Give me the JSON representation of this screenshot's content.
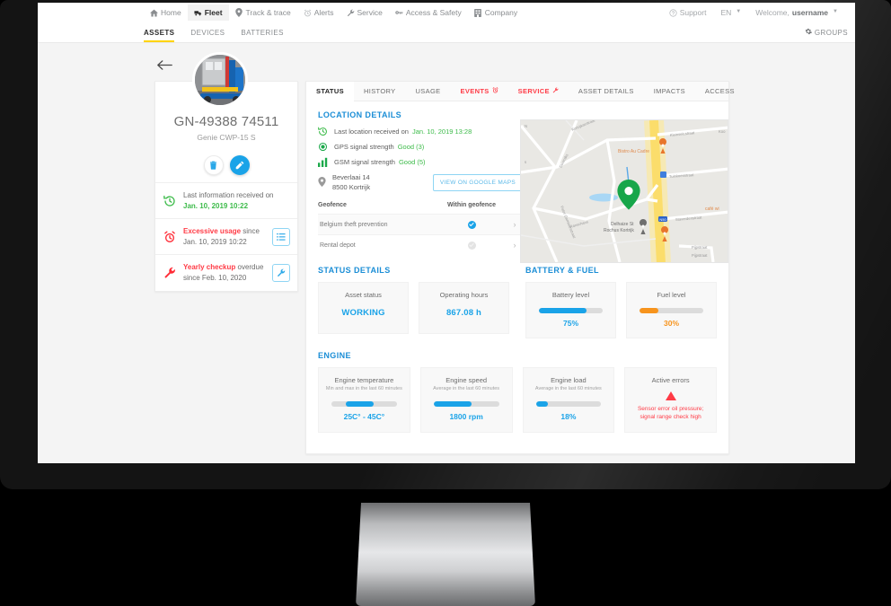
{
  "topnav": {
    "items": [
      {
        "label": "Home",
        "icon": "home-icon",
        "active": false
      },
      {
        "label": "Fleet",
        "icon": "truck-icon",
        "active": true
      },
      {
        "label": "Track & trace",
        "icon": "pin-icon",
        "active": false
      },
      {
        "label": "Alerts",
        "icon": "alarm-clock-icon",
        "active": false
      },
      {
        "label": "Service",
        "icon": "wrench-icon",
        "active": false
      },
      {
        "label": "Access & Safety",
        "icon": "key-icon",
        "active": false
      },
      {
        "label": "Company",
        "icon": "building-icon",
        "active": false
      }
    ],
    "support": "Support",
    "language": "EN",
    "welcome_prefix": "Welcome,",
    "username": "username"
  },
  "subnav": {
    "items": [
      {
        "label": "ASSETS",
        "active": true
      },
      {
        "label": "DEVICES",
        "active": false
      },
      {
        "label": "BATTERIES",
        "active": false
      }
    ],
    "groups_label": "GROUPS",
    "accent": "#ffd400"
  },
  "asset": {
    "back_label": "Back",
    "title": "GN-49388 74511",
    "subtitle": "Genie CWP-15 S",
    "delete_label": "Delete",
    "edit_label": "Edit",
    "rows": [
      {
        "icon": "history-clock-icon",
        "text_lead": "Last information received on",
        "text_value": "Jan. 10, 2019 10:22",
        "lead_style": "grey",
        "value_style": "green",
        "action_icon": null
      },
      {
        "icon": "alarm-clock-icon",
        "text_lead": "Excessive usage",
        "text_mid": " since",
        "text_value": "Jan. 10, 2019 10:22",
        "lead_style": "red",
        "value_style": "grey",
        "action_icon": "list-icon"
      },
      {
        "icon": "wrench-icon",
        "text_lead": "Yearly checkup",
        "text_mid": " overdue",
        "text_value": "since Feb. 10, 2020",
        "lead_style": "red",
        "value_style": "grey",
        "action_icon": "wrench-icon"
      }
    ]
  },
  "tabs": [
    {
      "label": "STATUS",
      "active": true,
      "style": "normal",
      "icon": null
    },
    {
      "label": "HISTORY",
      "active": false,
      "style": "normal",
      "icon": null
    },
    {
      "label": "USAGE",
      "active": false,
      "style": "normal",
      "icon": null
    },
    {
      "label": "EVENTS",
      "active": false,
      "style": "alert",
      "icon": "alarm-clock-icon"
    },
    {
      "label": "SERVICE",
      "active": false,
      "style": "alert",
      "icon": "wrench-icon"
    },
    {
      "label": "ASSET DETAILS",
      "active": false,
      "style": "normal",
      "icon": null
    },
    {
      "label": "IMPACTS",
      "active": false,
      "style": "normal",
      "icon": null
    },
    {
      "label": "ACCESS",
      "active": false,
      "style": "normal",
      "icon": null
    }
  ],
  "location": {
    "title": "LOCATION DETAILS",
    "last_received_label": "Last location received on",
    "last_received_value": "Jan. 10, 2019 13:28",
    "gps_label": "GPS signal strength",
    "gps_value": "Good (3)",
    "gsm_label": "GSM signal strength",
    "gsm_value": "Good (5)",
    "address_line1": "Beverlaai 14",
    "address_line2": "8500 Kortrijk",
    "maps_button": "VIEW ON GOOGLE MAPS",
    "geofence_header_name": "Geofence",
    "geofence_header_within": "Within geofence",
    "geofences": [
      {
        "name": "Belgium theft prevention",
        "within": true
      },
      {
        "name": "Rental depot",
        "within": false
      }
    ],
    "map_labels": [
      "Bistro Au Cadre",
      "Delhaize St Rochus Kortrijk",
      "Kortrijksestraat",
      "Doorniksesteenweg",
      "café wi",
      "Pijpstraat",
      "N50"
    ]
  },
  "status_details": {
    "title": "STATUS DETAILS",
    "cards": [
      {
        "label": "Asset status",
        "value": "WORKING"
      },
      {
        "label": "Operating hours",
        "value": "867.08 h"
      }
    ]
  },
  "battery_fuel": {
    "title": "BATTERY & FUEL",
    "cards": [
      {
        "label": "Battery level",
        "value": "75%",
        "percent": 75,
        "color": "#1aa3e8"
      },
      {
        "label": "Fuel level",
        "value": "30%",
        "percent": 30,
        "color": "#f7941d"
      }
    ]
  },
  "engine": {
    "title": "ENGINE",
    "cards": [
      {
        "label": "Engine temperature",
        "sublabel": "Min and max in the last 60 minutes",
        "value": "25C° - 45C°",
        "bar_start": 22,
        "bar_end": 65,
        "color": "#1aa3e8"
      },
      {
        "label": "Engine speed",
        "sublabel": "Average in the last 60 minutes",
        "value": "1800 rpm",
        "bar_start": 0,
        "bar_end": 58,
        "color": "#1aa3e8"
      },
      {
        "label": "Engine load",
        "sublabel": "Average in the last 60 minutes",
        "value": "18%",
        "bar_start": 0,
        "bar_end": 18,
        "color": "#1aa3e8"
      },
      {
        "label": "Active errors",
        "sublabel": "",
        "value": "Sensor error oil pressure; signal range check high",
        "is_error": true,
        "color": "#ff3b46"
      }
    ]
  },
  "colors": {
    "accent_blue": "#1aa3e8",
    "section_blue": "#1b8ed6",
    "alert_red": "#ff3b46",
    "ok_green": "#3dbb4a",
    "orange": "#f7941d",
    "yellow": "#ffd400"
  }
}
